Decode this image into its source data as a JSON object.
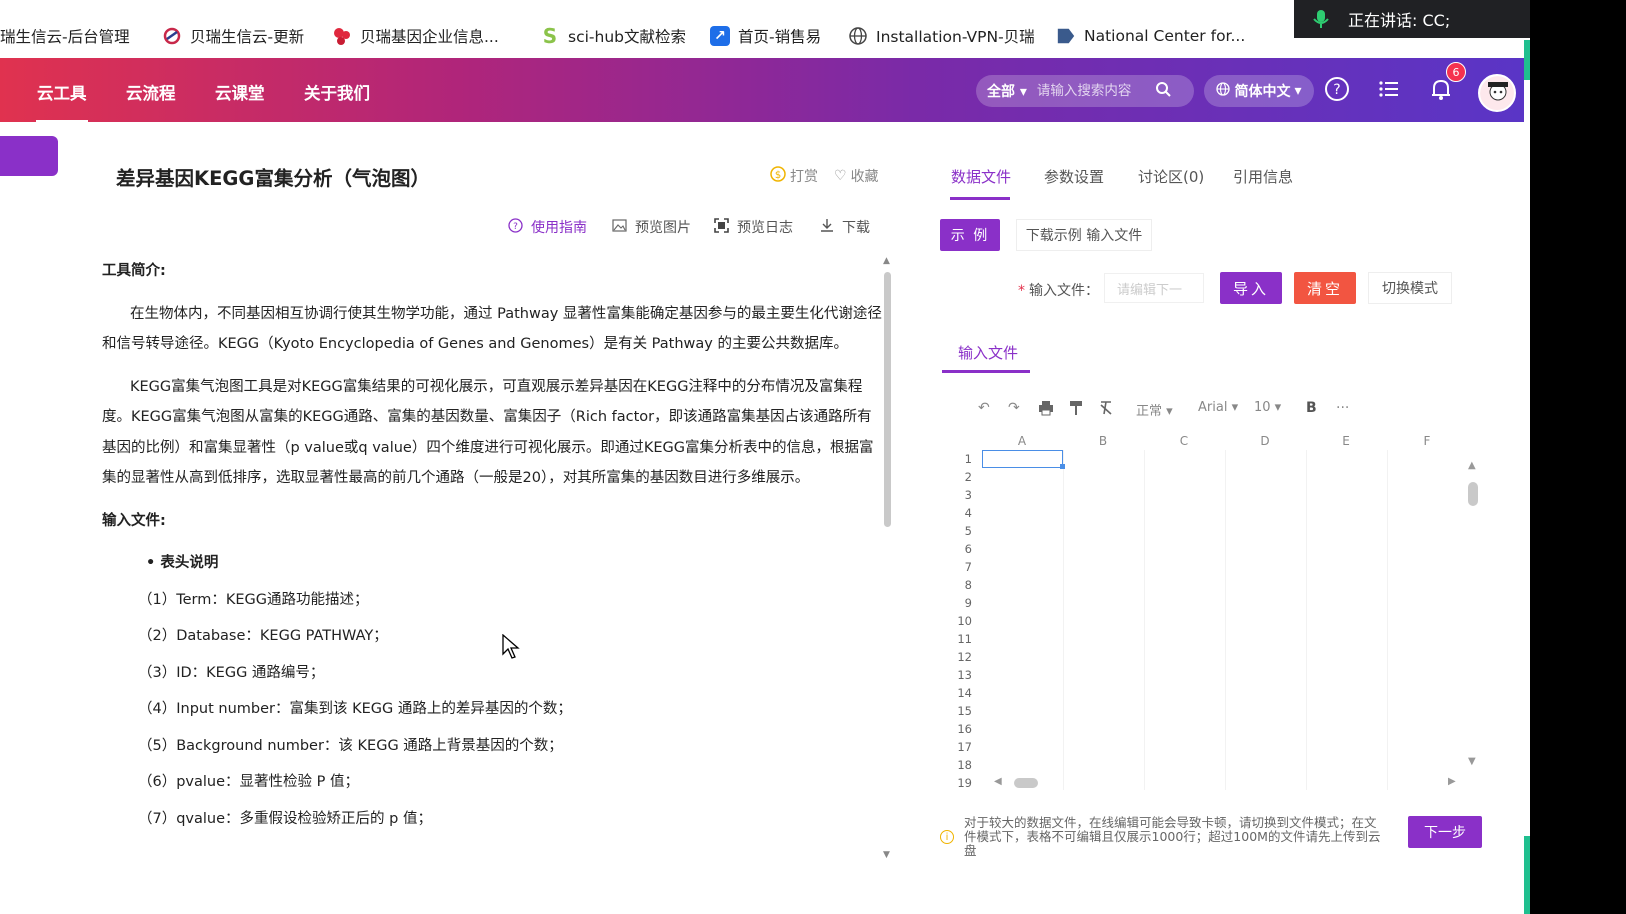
{
  "bookmarks": [
    {
      "label": "瑞生信云-后台管理",
      "icon": "none"
    },
    {
      "label": "贝瑞生信云-更新",
      "icon": "brand-swirl-icon"
    },
    {
      "label": "贝瑞基因企业信息...",
      "icon": "brand-petal-icon"
    },
    {
      "label": "sci-hub文献检索",
      "icon": "s-logo-icon"
    },
    {
      "label": "首页-销售易",
      "icon": "arrow-box-icon"
    },
    {
      "label": "Installation-VPN-贝瑞",
      "icon": "globe-icon"
    },
    {
      "label": "National Center for...",
      "icon": "ncbi-icon"
    }
  ],
  "meeting": {
    "status": "正在讲话:  CC;"
  },
  "nav": {
    "items": [
      "云工具",
      "云流程",
      "云课堂",
      "关于我们"
    ],
    "active": 0,
    "search_scope": "全部",
    "search_placeholder": "请输入搜索内容",
    "language": "简体中文",
    "notification_count": "6"
  },
  "tool": {
    "title": "差异基因KEGG富集分析（气泡图）",
    "reward": "打赏",
    "favorite": "收藏",
    "actions": [
      "使用指南",
      "预览图片",
      "预览日志",
      "下载"
    ]
  },
  "doc": {
    "intro_heading": "工具简介:",
    "para1": "在生物体内，不同基因相互协调行使其生物学功能，通过 Pathway 显著性富集能确定基因参与的最主要生化代谢途径和信号转导途径。KEGG（Kyoto Encyclopedia of Genes and Genomes）是有关 Pathway 的主要公共数据库。",
    "para2": "KEGG富集气泡图工具是对KEGG富集结果的可视化展示，可直观展示差异基因在KEGG注释中的分布情况及富集程度。KEGG富集气泡图从富集的KEGG通路、富集的基因数量、富集因子（Rich factor，即该通路富集基因占该通路所有基因的比例）和富集显著性（p value或q value）四个维度进行可视化展示。即通过KEGG富集分析表中的信息，根据富集的显著性从高到低排序，选取显著性最高的前几个通路（一般是20），对其所富集的基因数目进行多维展示。",
    "input_heading": "输入文件:",
    "bullet": "表头说明",
    "items": [
      "（1）Term：KEGG通路功能描述；",
      "（2）Database：KEGG PATHWAY；",
      "（3）ID：KEGG 通路编号；",
      "（4）Input number：富集到该 KEGG 通路上的差异基因的个数；",
      "（5）Background number：该 KEGG 通路上背景基因的个数；",
      "（6）pvalue：显著性检验 P 值；",
      "（7）qvalue：多重假设检验矫正后的 p 值；"
    ]
  },
  "right": {
    "tabs": [
      "数据文件",
      "参数设置",
      "讨论区(0)",
      "引用信息"
    ],
    "example_btn": "示 例",
    "download_example": "下载示例 输入文件",
    "input_label": "输入文件：",
    "input_placeholder": "请编辑下一",
    "import_btn": "导入",
    "clear_btn": "清空",
    "switch_mode": "切换模式",
    "input_tab": "输入文件",
    "toolbar": {
      "style": "正常",
      "font": "Arial",
      "size": "10"
    },
    "columns": [
      "A",
      "B",
      "C",
      "D",
      "E",
      "F"
    ],
    "rows": [
      "1",
      "2",
      "3",
      "4",
      "5",
      "6",
      "7",
      "8",
      "9",
      "10",
      "11",
      "12",
      "13",
      "14",
      "15",
      "16",
      "17",
      "18",
      "19"
    ],
    "note": "对于较大的数据文件，在线编辑可能会导致卡顿，请切换到文件模式；在文件模式下，表格不可编辑且仅展示1000行；超过100M的文件请先上传到云盘",
    "next_btn": "下一步"
  },
  "colors": {
    "accent": "#8a30c8",
    "danger": "#f25541",
    "nav_start": "#e0324f",
    "nav_end": "#5a35c6"
  }
}
